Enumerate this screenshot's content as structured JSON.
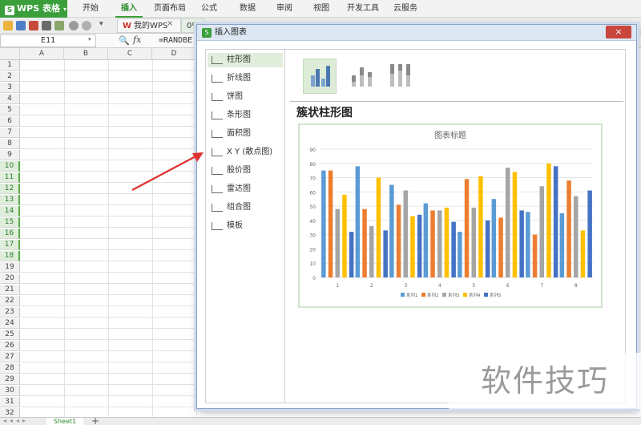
{
  "app": {
    "menu_label": "WPS 表格",
    "logo_glyph": "S",
    "caret": "▾"
  },
  "ribbon": {
    "tabs": [
      "开始",
      "插入",
      "页面布局",
      "公式",
      "数据",
      "审阅",
      "视图",
      "开发工具",
      "云服务"
    ],
    "active_tab": "插入"
  },
  "doc_tabs": {
    "wps_prefix": "W",
    "wps_label": "我的WPS",
    "close_glyph": "×",
    "file_label": "0%"
  },
  "formula_bar": {
    "name_box": "E11",
    "name_caret": "▾",
    "zoom_glyph": "🔍",
    "fx": "fx",
    "formula": "=RANDBE"
  },
  "grid": {
    "columns": [
      "A",
      "B",
      "C",
      "D"
    ],
    "rows": [
      "1",
      "2",
      "3",
      "4",
      "5",
      "6",
      "7",
      "8",
      "9",
      "10",
      "11",
      "12",
      "13",
      "14",
      "15",
      "16",
      "17",
      "18",
      "19",
      "20",
      "21",
      "22",
      "23",
      "24",
      "25",
      "26",
      "27",
      "28",
      "29",
      "30",
      "31",
      "32"
    ],
    "selected_rows": [
      "10",
      "11",
      "12",
      "13",
      "14",
      "15",
      "16",
      "17",
      "18"
    ]
  },
  "sheet_bar": {
    "nav": "◂◂◂▸",
    "sheet_name": "Sheet1",
    "add_glyph": "+"
  },
  "dialog": {
    "icon_glyph": "S",
    "title": "插入图表",
    "close_glyph": "×",
    "chart_types": [
      {
        "label": "柱形图",
        "icon": "column-chart-icon"
      },
      {
        "label": "折线图",
        "icon": "line-chart-icon"
      },
      {
        "label": "饼图",
        "icon": "pie-chart-icon"
      },
      {
        "label": "条形图",
        "icon": "bar-chart-icon"
      },
      {
        "label": "面积图",
        "icon": "area-chart-icon"
      },
      {
        "label": "X Y (散点图)",
        "icon": "scatter-chart-icon"
      },
      {
        "label": "股价图",
        "icon": "stock-chart-icon"
      },
      {
        "label": "雷达图",
        "icon": "radar-chart-icon"
      },
      {
        "label": "组合图",
        "icon": "combo-chart-icon"
      },
      {
        "label": "模板",
        "icon": "template-icon"
      }
    ],
    "active_type": "柱形图",
    "subtypes": [
      "clustered-column-icon",
      "stacked-column-icon",
      "percent-stacked-column-icon"
    ],
    "selected_subtype": "clustered-column-icon",
    "preview_heading": "簇状柱形图"
  },
  "colors": {
    "accent_green": "#3a9e3a",
    "arrow_red": "#e03030",
    "series1": "#5b9bd5",
    "series2": "#ed7d31",
    "series3": "#a5a5a5",
    "series4": "#ffc000",
    "series5": "#4472c4"
  },
  "watermark": "软件技巧",
  "chart_data": {
    "type": "bar",
    "title": "图表标题",
    "categories": [
      "1",
      "2",
      "3",
      "4",
      "5",
      "6",
      "7",
      "8"
    ],
    "series": [
      {
        "name": "系列1",
        "values": [
          75,
          78,
          65,
          52,
          32,
          55,
          46,
          45
        ]
      },
      {
        "name": "系列2",
        "values": [
          75,
          48,
          51,
          47,
          69,
          42,
          30,
          68
        ]
      },
      {
        "name": "系列3",
        "values": [
          48,
          36,
          61,
          47,
          49,
          77,
          64,
          57
        ]
      },
      {
        "name": "系列4",
        "values": [
          58,
          70,
          43,
          49,
          71,
          74,
          80,
          33
        ]
      },
      {
        "name": "系列5",
        "values": [
          32,
          33,
          44,
          39,
          40,
          47,
          78,
          61
        ]
      }
    ],
    "ylim": [
      0,
      90
    ],
    "yticks": [
      0,
      10,
      20,
      30,
      40,
      50,
      60,
      70,
      80,
      90
    ],
    "grid": true,
    "legend": "bottom"
  }
}
